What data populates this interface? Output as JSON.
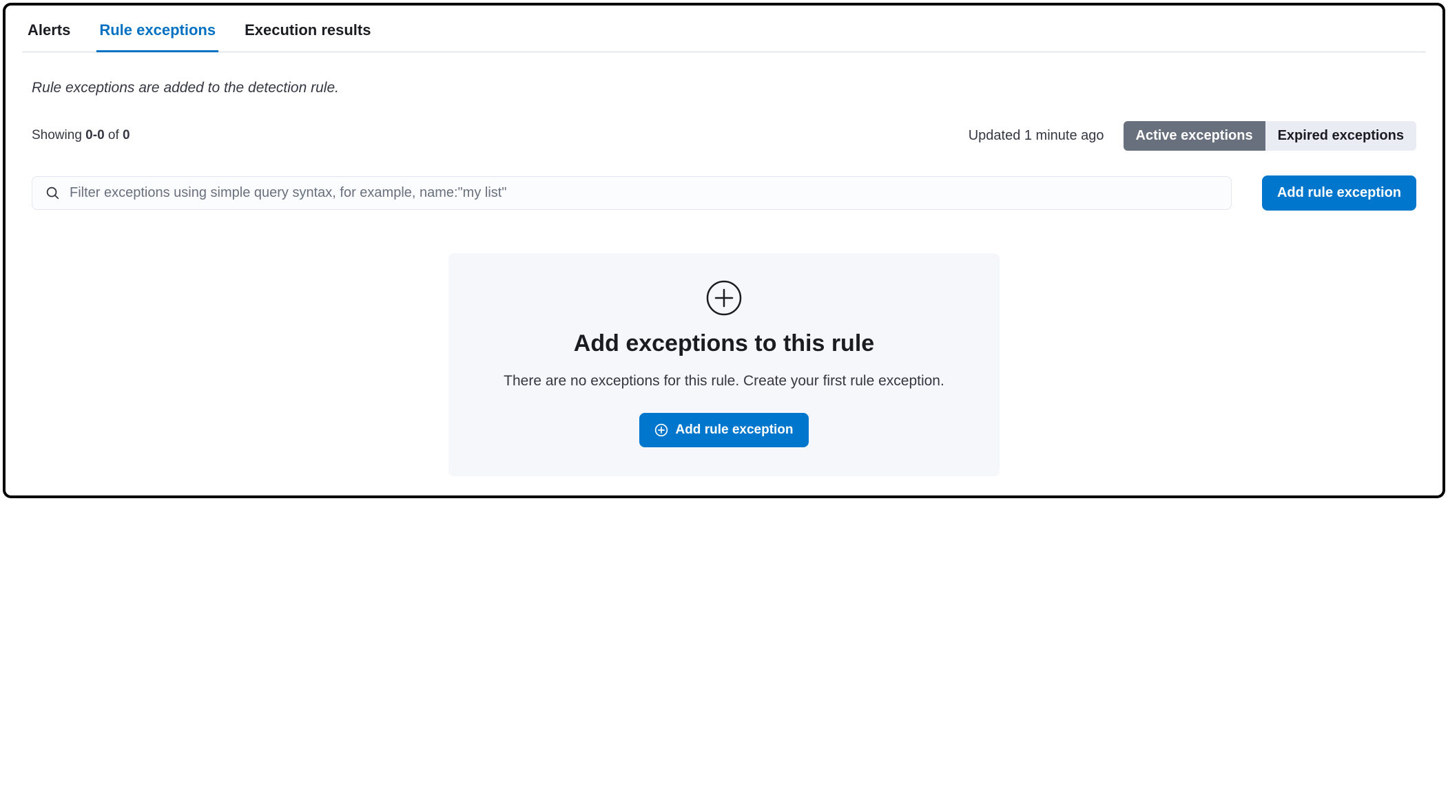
{
  "tabs": {
    "alerts": "Alerts",
    "rule_exceptions": "Rule exceptions",
    "execution_results": "Execution results"
  },
  "description": "Rule exceptions are added to the detection rule.",
  "showing": {
    "prefix": "Showing ",
    "range": "0-0",
    "of": " of ",
    "total": "0"
  },
  "updated": "Updated 1 minute ago",
  "toggle": {
    "active": "Active exceptions",
    "expired": "Expired exceptions"
  },
  "search": {
    "placeholder": "Filter exceptions using simple query syntax, for example, name:\"my list\""
  },
  "buttons": {
    "add_rule_exception": "Add rule exception"
  },
  "empty": {
    "title": "Add exceptions to this rule",
    "description": "There are no exceptions for this rule. Create your first rule exception.",
    "button": "Add rule exception"
  },
  "colors": {
    "primary": "#0077cc",
    "toggle_selected": "#69707d"
  }
}
